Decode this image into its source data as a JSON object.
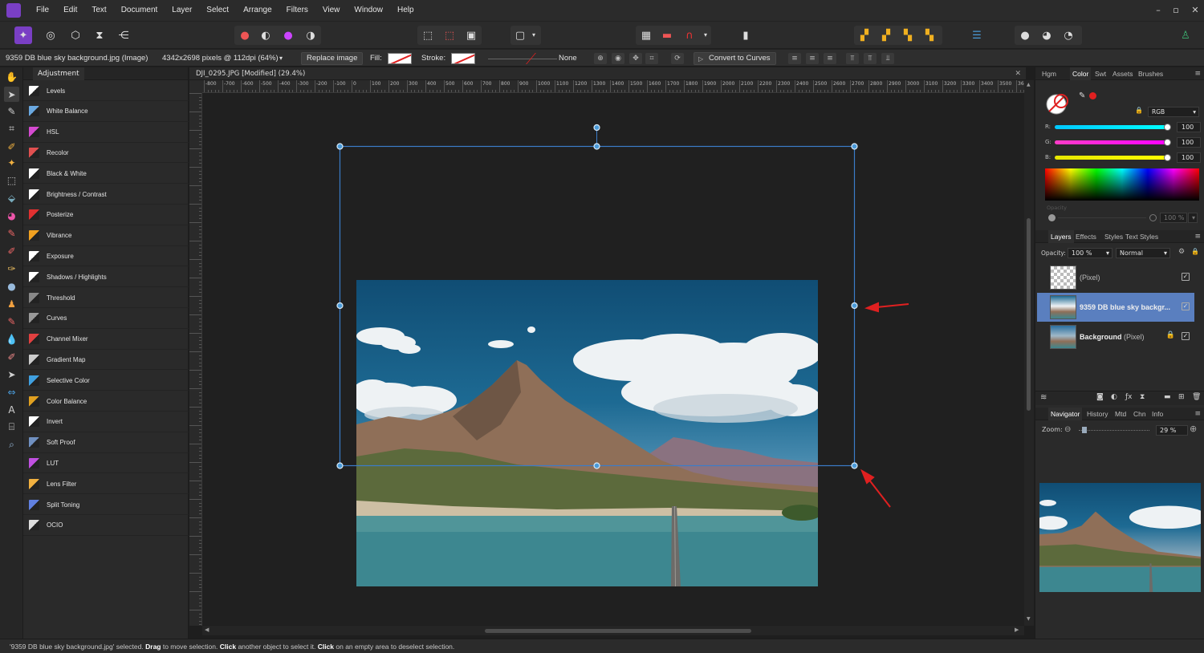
{
  "menubar": {
    "items": [
      "File",
      "Edit",
      "Text",
      "Document",
      "Layer",
      "Select",
      "Arrange",
      "Filters",
      "View",
      "Window",
      "Help"
    ],
    "window_controls": [
      "–",
      "▫",
      "✕"
    ]
  },
  "context_bar": {
    "selection_name": "9359 DB blue sky background.jpg (Image)",
    "dimensions": "4342x2698 pixels @ 112dpi (64%)",
    "replace_image_label": "Replace image",
    "fill_label": "Fill:",
    "stroke_label": "Stroke:",
    "stroke_style": "None",
    "convert_to_curves_label": "Convert to Curves"
  },
  "adjustment_panel": {
    "tab_label": "Adjustment",
    "items": [
      {
        "label": "Levels",
        "color": "#ffffff"
      },
      {
        "label": "White Balance",
        "color": "#6aa8e0"
      },
      {
        "label": "HSL",
        "color": "#d44ad0"
      },
      {
        "label": "Recolor",
        "color": "#e05050"
      },
      {
        "label": "Black & White",
        "color": "#ffffff"
      },
      {
        "label": "Brightness / Contrast",
        "color": "#ffffff"
      },
      {
        "label": "Posterize",
        "color": "#e03030"
      },
      {
        "label": "Vibrance",
        "color": "#f0a020"
      },
      {
        "label": "Exposure",
        "color": "#ffffff"
      },
      {
        "label": "Shadows / Highlights",
        "color": "#ffffff"
      },
      {
        "label": "Threshold",
        "color": "#888888"
      },
      {
        "label": "Curves",
        "color": "#999999"
      },
      {
        "label": "Channel Mixer",
        "color": "#e04040"
      },
      {
        "label": "Gradient Map",
        "color": "#cccccc"
      },
      {
        "label": "Selective Color",
        "color": "#40a0e0"
      },
      {
        "label": "Color Balance",
        "color": "#e0a020"
      },
      {
        "label": "Invert",
        "color": "#ffffff"
      },
      {
        "label": "Soft Proof",
        "color": "#7090c0"
      },
      {
        "label": "LUT",
        "color": "#c050e0"
      },
      {
        "label": "Lens Filter",
        "color": "#f0b040"
      },
      {
        "label": "Split Toning",
        "color": "#6080e0"
      },
      {
        "label": "OCIO",
        "color": "#dddddd"
      }
    ]
  },
  "document": {
    "tab_title": "DJI_0295.JPG [Modified] (29.4%)",
    "close_glyph": "✕",
    "ruler_labels": [
      "-800",
      "-700",
      "-600",
      "-500",
      "-400",
      "-300",
      "-200",
      "-100",
      "0",
      "100",
      "200",
      "300",
      "400",
      "500",
      "600",
      "700",
      "800",
      "900",
      "1000",
      "1100",
      "1200",
      "1300",
      "1400",
      "1500",
      "1600",
      "1700",
      "1800",
      "1900",
      "2000",
      "2100",
      "2200",
      "2300",
      "2400",
      "2500",
      "2600",
      "2700",
      "2800",
      "2900",
      "3000",
      "3100",
      "3200",
      "3300",
      "3400",
      "3500",
      "36"
    ]
  },
  "color_panel": {
    "tabs": [
      "Hgm",
      "Color",
      "Swt",
      "Assets",
      "Brushes"
    ],
    "active_tab": "Color",
    "model": "RGB",
    "channels": [
      {
        "label": "R:",
        "value": "100",
        "color": "#00e5ff"
      },
      {
        "label": "G:",
        "value": "100",
        "color": "#ff00ff"
      },
      {
        "label": "B:",
        "value": "100",
        "color": "#ffee00"
      }
    ],
    "opacity_label": "Opacity",
    "opacity_value": "100 %"
  },
  "layers_panel": {
    "tabs": [
      "Layers",
      "Effects",
      "Styles",
      "Text Styles"
    ],
    "active_tab": "Layers",
    "opacity_label": "Opacity:",
    "opacity_value": "100 %",
    "blend_mode": "Normal",
    "layers": [
      {
        "name": "",
        "suffix": "(Pixel)",
        "selected": false,
        "locked": false
      },
      {
        "name": "9359 DB blue sky backgr...",
        "suffix": "",
        "selected": true,
        "locked": false
      },
      {
        "name": "Background",
        "suffix": " (Pixel)",
        "selected": false,
        "locked": true
      }
    ]
  },
  "navigator_panel": {
    "tabs": [
      "Navigator",
      "History",
      "Mtd",
      "Chn",
      "Info"
    ],
    "active_tab": "Navigator",
    "zoom_label": "Zoom:",
    "zoom_value": "29 %"
  },
  "statusbar": {
    "selected_text": "'9359 DB blue sky background.jpg' selected.",
    "drag_label": "Drag",
    "drag_text": " to move selection.",
    "click_label": "Click",
    "click_text": " another object to select it.",
    "click2_label": "Click",
    "click2_text": " on an empty area to deselect selection."
  },
  "colors": {
    "accent": "#7a3fc4",
    "selection_handle": "#4a9ad8",
    "selection_outline": "#3b7cc9",
    "annotation_arrow": "#e02020",
    "layer_selected": "#5a7fbf"
  }
}
